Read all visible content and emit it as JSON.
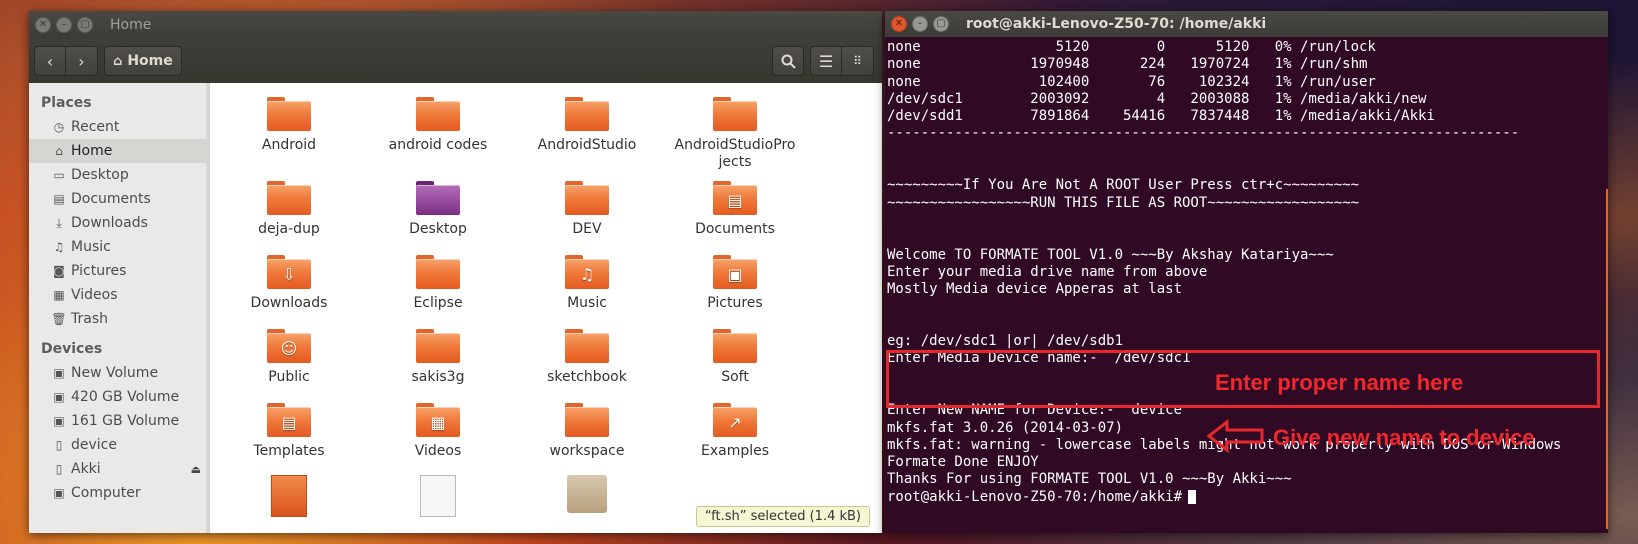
{
  "file_manager": {
    "window_title": "Home",
    "breadcrumb": "Home",
    "sidebar": {
      "places_heading": "Places",
      "places": [
        {
          "label": "Recent",
          "icon": "clock-icon"
        },
        {
          "label": "Home",
          "icon": "home-icon",
          "selected": true
        },
        {
          "label": "Desktop",
          "icon": "desktop-icon"
        },
        {
          "label": "Documents",
          "icon": "document-icon"
        },
        {
          "label": "Downloads",
          "icon": "download-icon"
        },
        {
          "label": "Music",
          "icon": "music-icon"
        },
        {
          "label": "Pictures",
          "icon": "camera-icon"
        },
        {
          "label": "Videos",
          "icon": "film-icon"
        },
        {
          "label": "Trash",
          "icon": "trash-icon"
        }
      ],
      "devices_heading": "Devices",
      "devices": [
        {
          "label": "New Volume",
          "icon": "drive-icon"
        },
        {
          "label": "420 GB Volume",
          "icon": "drive-icon"
        },
        {
          "label": "161 GB Volume",
          "icon": "drive-icon"
        },
        {
          "label": "device",
          "icon": "usb-icon"
        },
        {
          "label": "Akki",
          "icon": "usb-icon",
          "ejectable": true
        },
        {
          "label": "Computer",
          "icon": "drive-icon"
        }
      ]
    },
    "files": [
      [
        "Android",
        "android codes",
        "AndroidStudio",
        "AndroidStudioProjects"
      ],
      [
        "deja-dup",
        "Desktop",
        "DEV",
        "Documents"
      ],
      [
        "Downloads",
        "Eclipse",
        "Music",
        "Pictures"
      ],
      [
        "Public",
        "sakis3g",
        "sketchbook",
        "Soft"
      ],
      [
        "Templates",
        "Videos",
        "workspace",
        "Examples"
      ]
    ],
    "status": "“ft.sh” selected  (1.4 kB)"
  },
  "terminal": {
    "window_title": "root@akki-Lenovo-Z50-70: /home/akki",
    "lines": [
      "none                5120        0      5120   0% /run/lock",
      "none             1970948      224   1970724   1% /run/shm",
      "none              102400       76    102324   1% /run/user",
      "/dev/sdc1        2003092        4   2003088   1% /media/akki/new",
      "/dev/sdd1        7891864    54416   7837448   1% /media/akki/Akki",
      "---------------------------------------------------------------------------",
      "",
      "",
      "~~~~~~~~~If You Are Not A ROOT User Press ctr+c~~~~~~~~~",
      "~~~~~~~~~~~~~~~~~RUN THIS FILE AS ROOT~~~~~~~~~~~~~~~~~~",
      "",
      "",
      "Welcome TO FORMATE TOOL V1.0 ~~~By Akshay Katariya~~~",
      "Enter your media drive name from above",
      "Mostly Media device Apperas at last",
      "",
      "",
      "eg: /dev/sdc1 |or| /dev/sdb1",
      "Enter Media Device name:-  /dev/sdc1",
      "",
      "",
      "Enter New NAME for Device:-  device",
      "mkfs.fat 3.0.26 (2014-03-07)",
      "mkfs.fat: warning - lowercase labels might not work properly with DOS or Windows",
      "Formate Done ENJOY",
      "Thanks For using FORMATE TOOL V1.0 ~~~By Akki~~~",
      "root@akki-Lenovo-Z50-70:/home/akki# "
    ],
    "annotation_1": "Enter proper name here",
    "annotation_2": "Give new name to device"
  }
}
